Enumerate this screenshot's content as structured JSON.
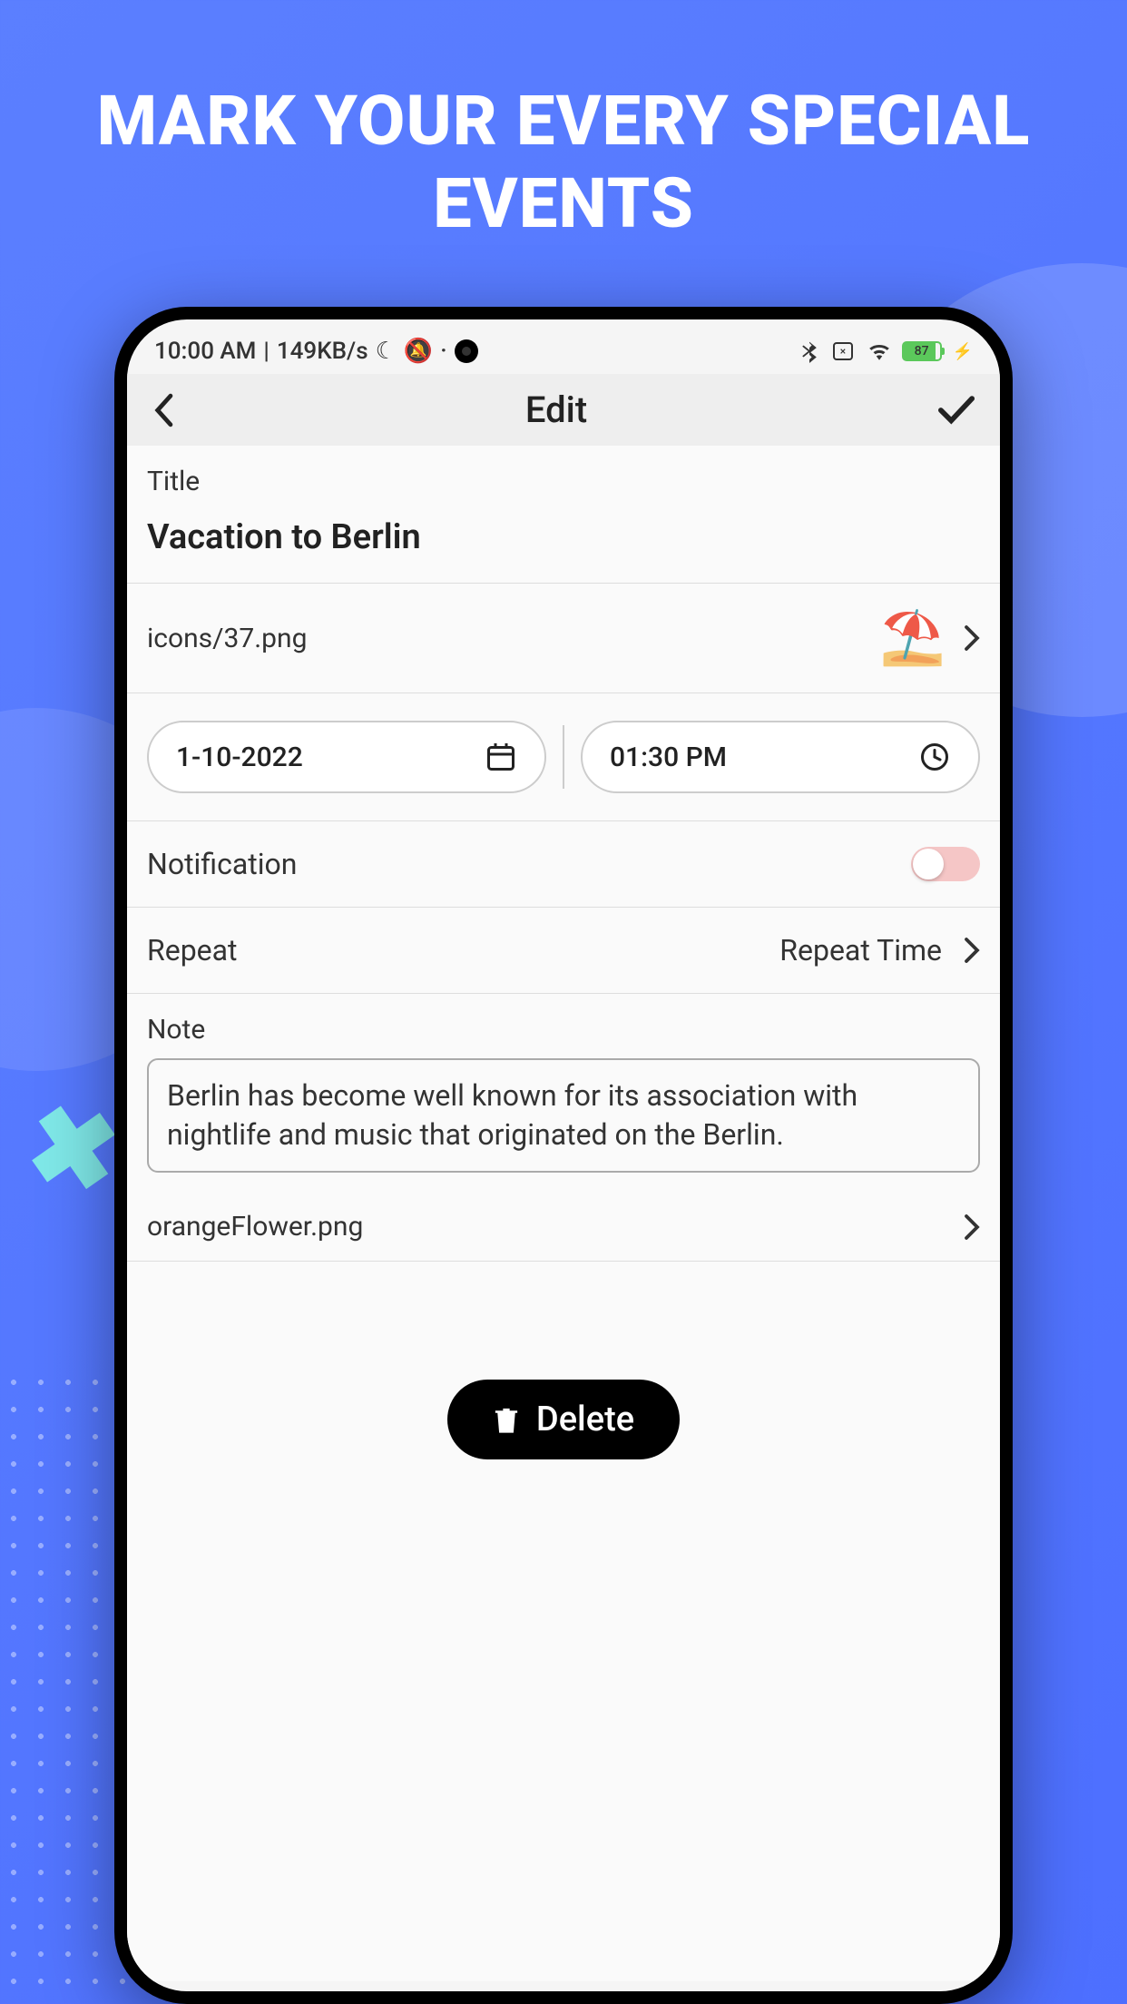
{
  "headline": "MARK YOUR EVERY SPECIAL EVENTS",
  "status": {
    "time": "10:00 AM",
    "speed": "149KB/s",
    "battery": "87"
  },
  "nav": {
    "title": "Edit"
  },
  "form": {
    "title_label": "Title",
    "title_value": "Vacation to Berlin",
    "icon_path": "icons/37.png",
    "date": "1-10-2022",
    "time": "01:30 PM",
    "notification_label": "Notification",
    "notification_on": false,
    "repeat_label": "Repeat",
    "repeat_value": "Repeat Time",
    "note_label": "Note",
    "note_value": "Berlin has become well known for its association with nightlife and music that originated on the Berlin.",
    "attachment": "orangeFlower.png",
    "delete_label": "Delete"
  }
}
